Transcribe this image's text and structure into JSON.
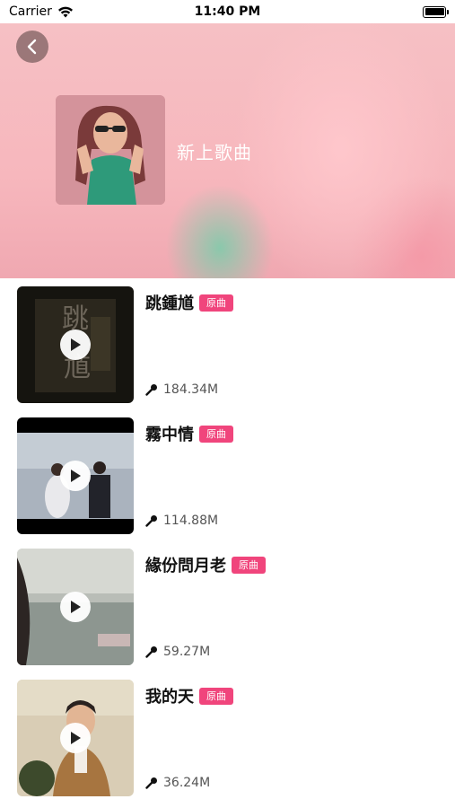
{
  "status_bar": {
    "carrier": "Carrier",
    "time": "11:40 PM"
  },
  "header": {
    "title": "新上歌曲",
    "back_icon": "chevron-left-icon"
  },
  "songs": [
    {
      "title": "跳鍾馗",
      "badge": "原曲",
      "plays": "184.34M"
    },
    {
      "title": "霧中情",
      "badge": "原曲",
      "plays": "114.88M"
    },
    {
      "title": "緣份問月老",
      "badge": "原曲",
      "plays": "59.27M"
    },
    {
      "title": "我的天",
      "badge": "原曲",
      "plays": "36.24M"
    }
  ],
  "colors": {
    "badge": "#f0457c",
    "header_pink": "#f6c0c4",
    "header_green": "#78cdaa"
  }
}
